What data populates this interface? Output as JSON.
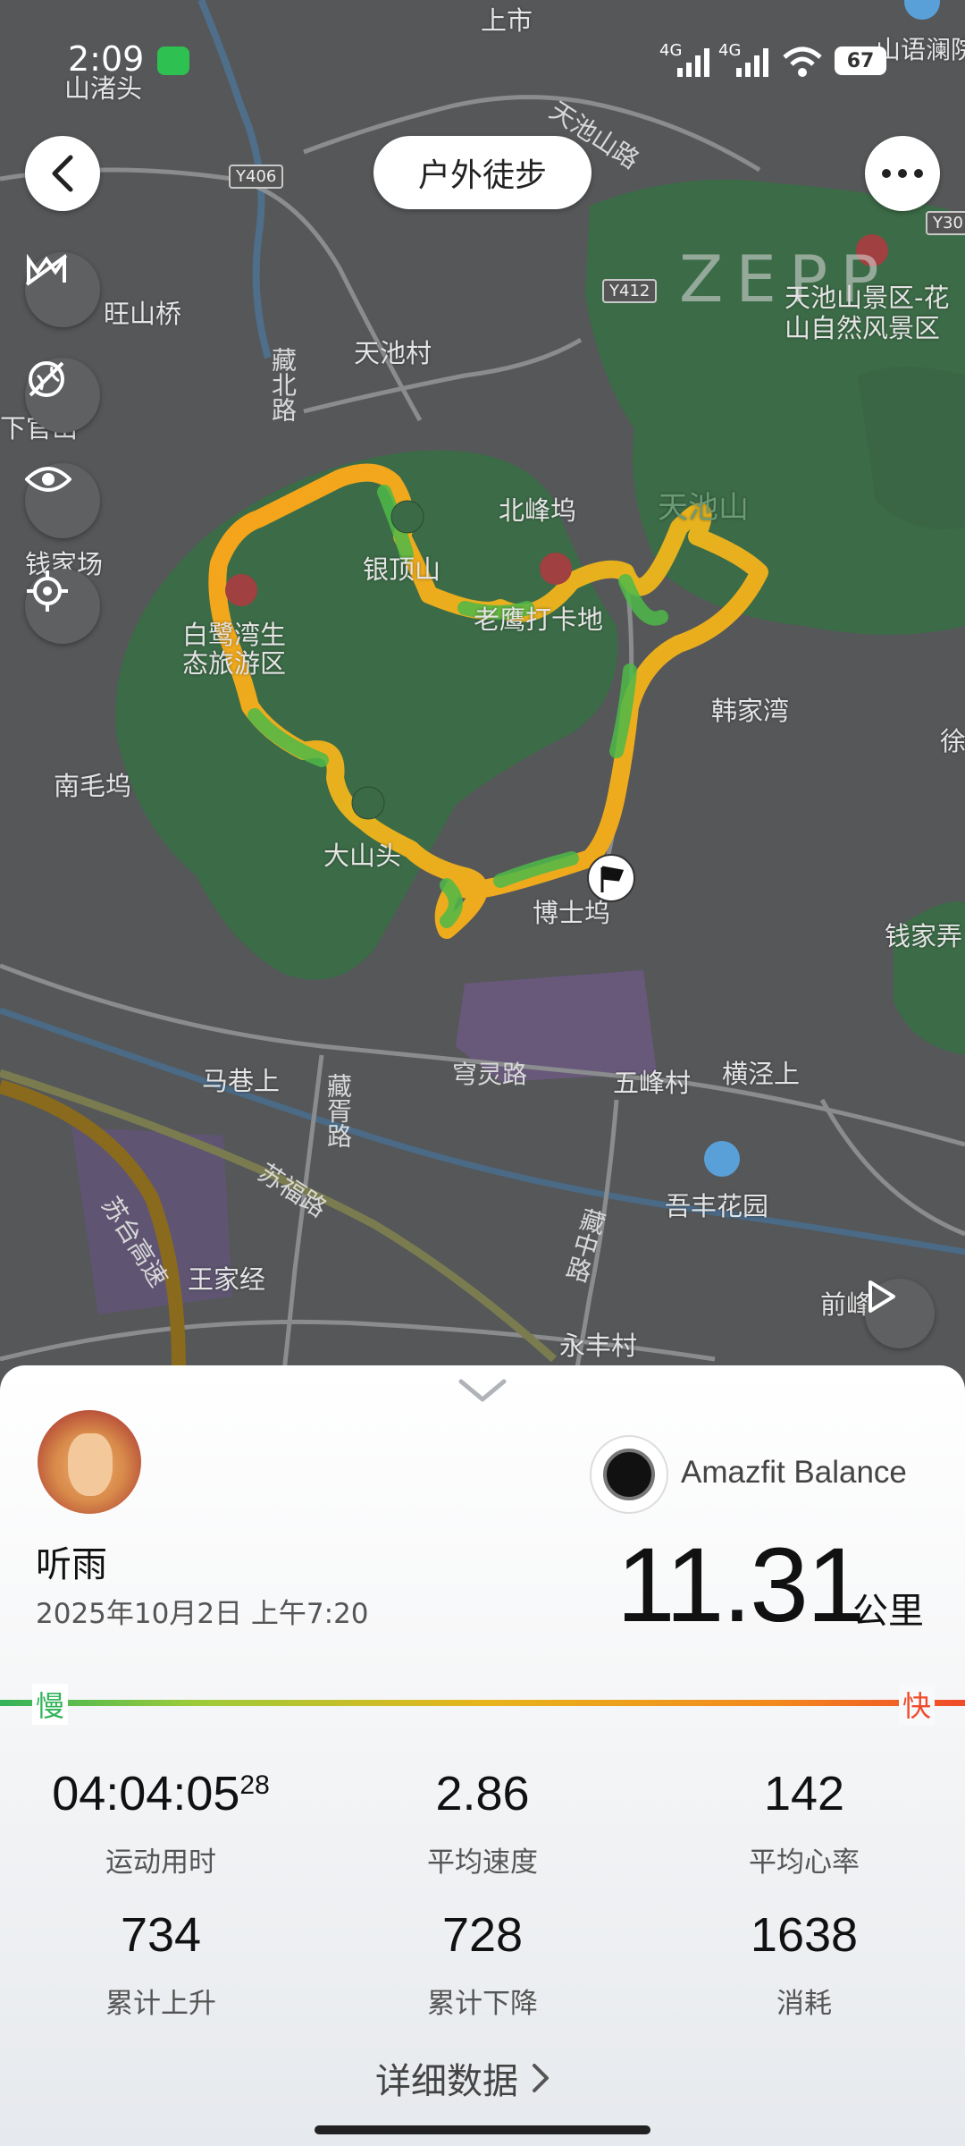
{
  "status_bar": {
    "time": "2:09",
    "network": "4G",
    "battery": "67"
  },
  "header": {
    "title": "户外徒步"
  },
  "map": {
    "watermark": "ZEPP",
    "labels": [
      "上市",
      "山语澜院",
      "山渚头",
      "天池山路",
      "旺山桥",
      "天池村",
      "天池山景区-花山自然风景区",
      "藏北路",
      "下官山",
      "北峰坞",
      "天池山",
      "钱家场",
      "银顶山",
      "老鹰打卡地",
      "白鹭湾生态旅游区",
      "韩家湾",
      "南毛坞",
      "徐",
      "大山头",
      "博士坞",
      "钱家弄",
      "马巷上",
      "穹灵路",
      "五峰村",
      "横泾上",
      "藏胥路",
      "苏福路",
      "吾丰花园",
      "苏台高速",
      "王家经",
      "藏中路",
      "前峰村",
      "永丰村"
    ],
    "road_codes": [
      "Y406",
      "Y412",
      "Y30"
    ]
  },
  "summary": {
    "user_name": "听雨",
    "datetime": "2025年10月2日 上午7:20",
    "device": "Amazfit Balance",
    "distance": "11.31",
    "distance_unit": "公里",
    "pace_slow": "慢",
    "pace_fast": "快",
    "stats": [
      {
        "value": "04:04:05",
        "suffix": "28",
        "label": "运动用时"
      },
      {
        "value": "2.86",
        "suffix": "",
        "label": "平均速度"
      },
      {
        "value": "142",
        "suffix": "",
        "label": "平均心率"
      },
      {
        "value": "734",
        "suffix": "",
        "label": "累计上升"
      },
      {
        "value": "728",
        "suffix": "",
        "label": "累计下降"
      },
      {
        "value": "1638",
        "suffix": "",
        "label": "消耗"
      }
    ],
    "detail_link": "详细数据"
  },
  "colors": {
    "track_fast": "#f7a21b",
    "track_slow": "#4db848",
    "park": "#3c6b47",
    "accent_green": "#33b35a",
    "accent_red": "#f04a2a"
  }
}
